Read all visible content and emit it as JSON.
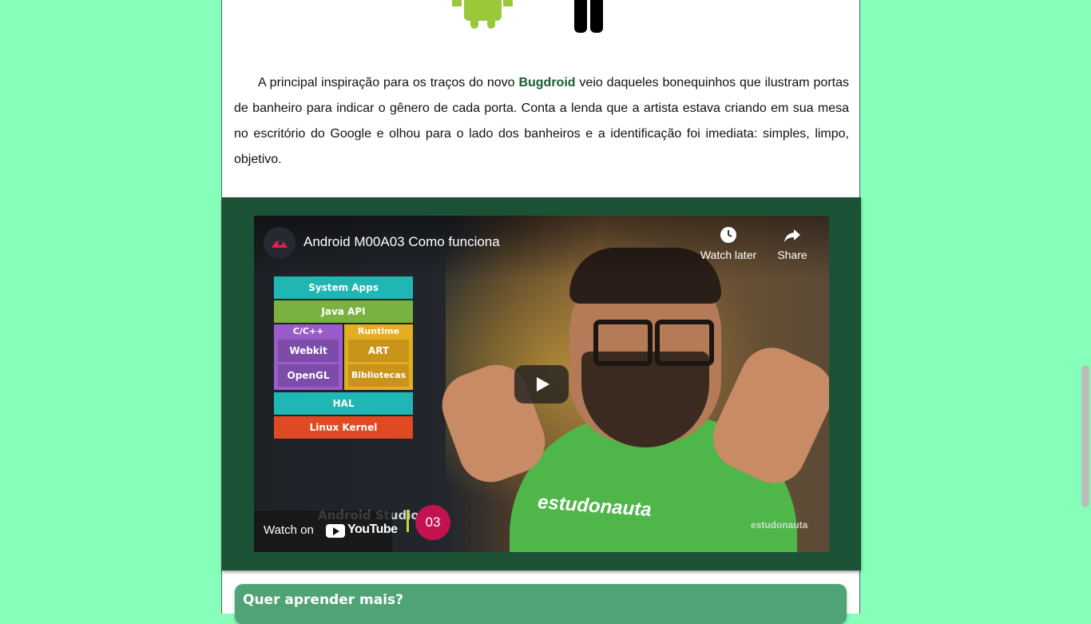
{
  "article": {
    "paragraph_before": "A principal inspiração para os traços do novo ",
    "highlight": "Bugdroid",
    "paragraph_after": " veio daqueles bonequinhos que ilustram portas de banheiro para indicar o gênero de cada porta. Conta a lenda que a artista estava criando em sua mesa no escritório do Google e olhou para o lado dos banheiros e a identificação foi imediata: simples, limpo, objetivo."
  },
  "video": {
    "title": "Android M00A03 Como funciona",
    "watch_later": "Watch later",
    "share": "Share",
    "watch_on": "Watch on",
    "youtube": "YouTube",
    "studio_text": "Android Studio",
    "episode": "03",
    "brand": "estudonauta",
    "stack": {
      "system_apps": "System Apps",
      "java_api": "Java API",
      "cpp": "C/C++",
      "runtime": "Runtime",
      "webkit": "Webkit",
      "art": "ART",
      "opengl": "OpenGL",
      "bibliotecas": "Bibliotecas",
      "hal": "HAL",
      "linux_kernel": "Linux Kernel"
    }
  },
  "more": {
    "title": "Quer aprender mais?"
  },
  "colors": {
    "background": "#86ffba",
    "highlight": "#1a5c34",
    "video_band": "#1b5235",
    "more_box": "#4fa375"
  }
}
